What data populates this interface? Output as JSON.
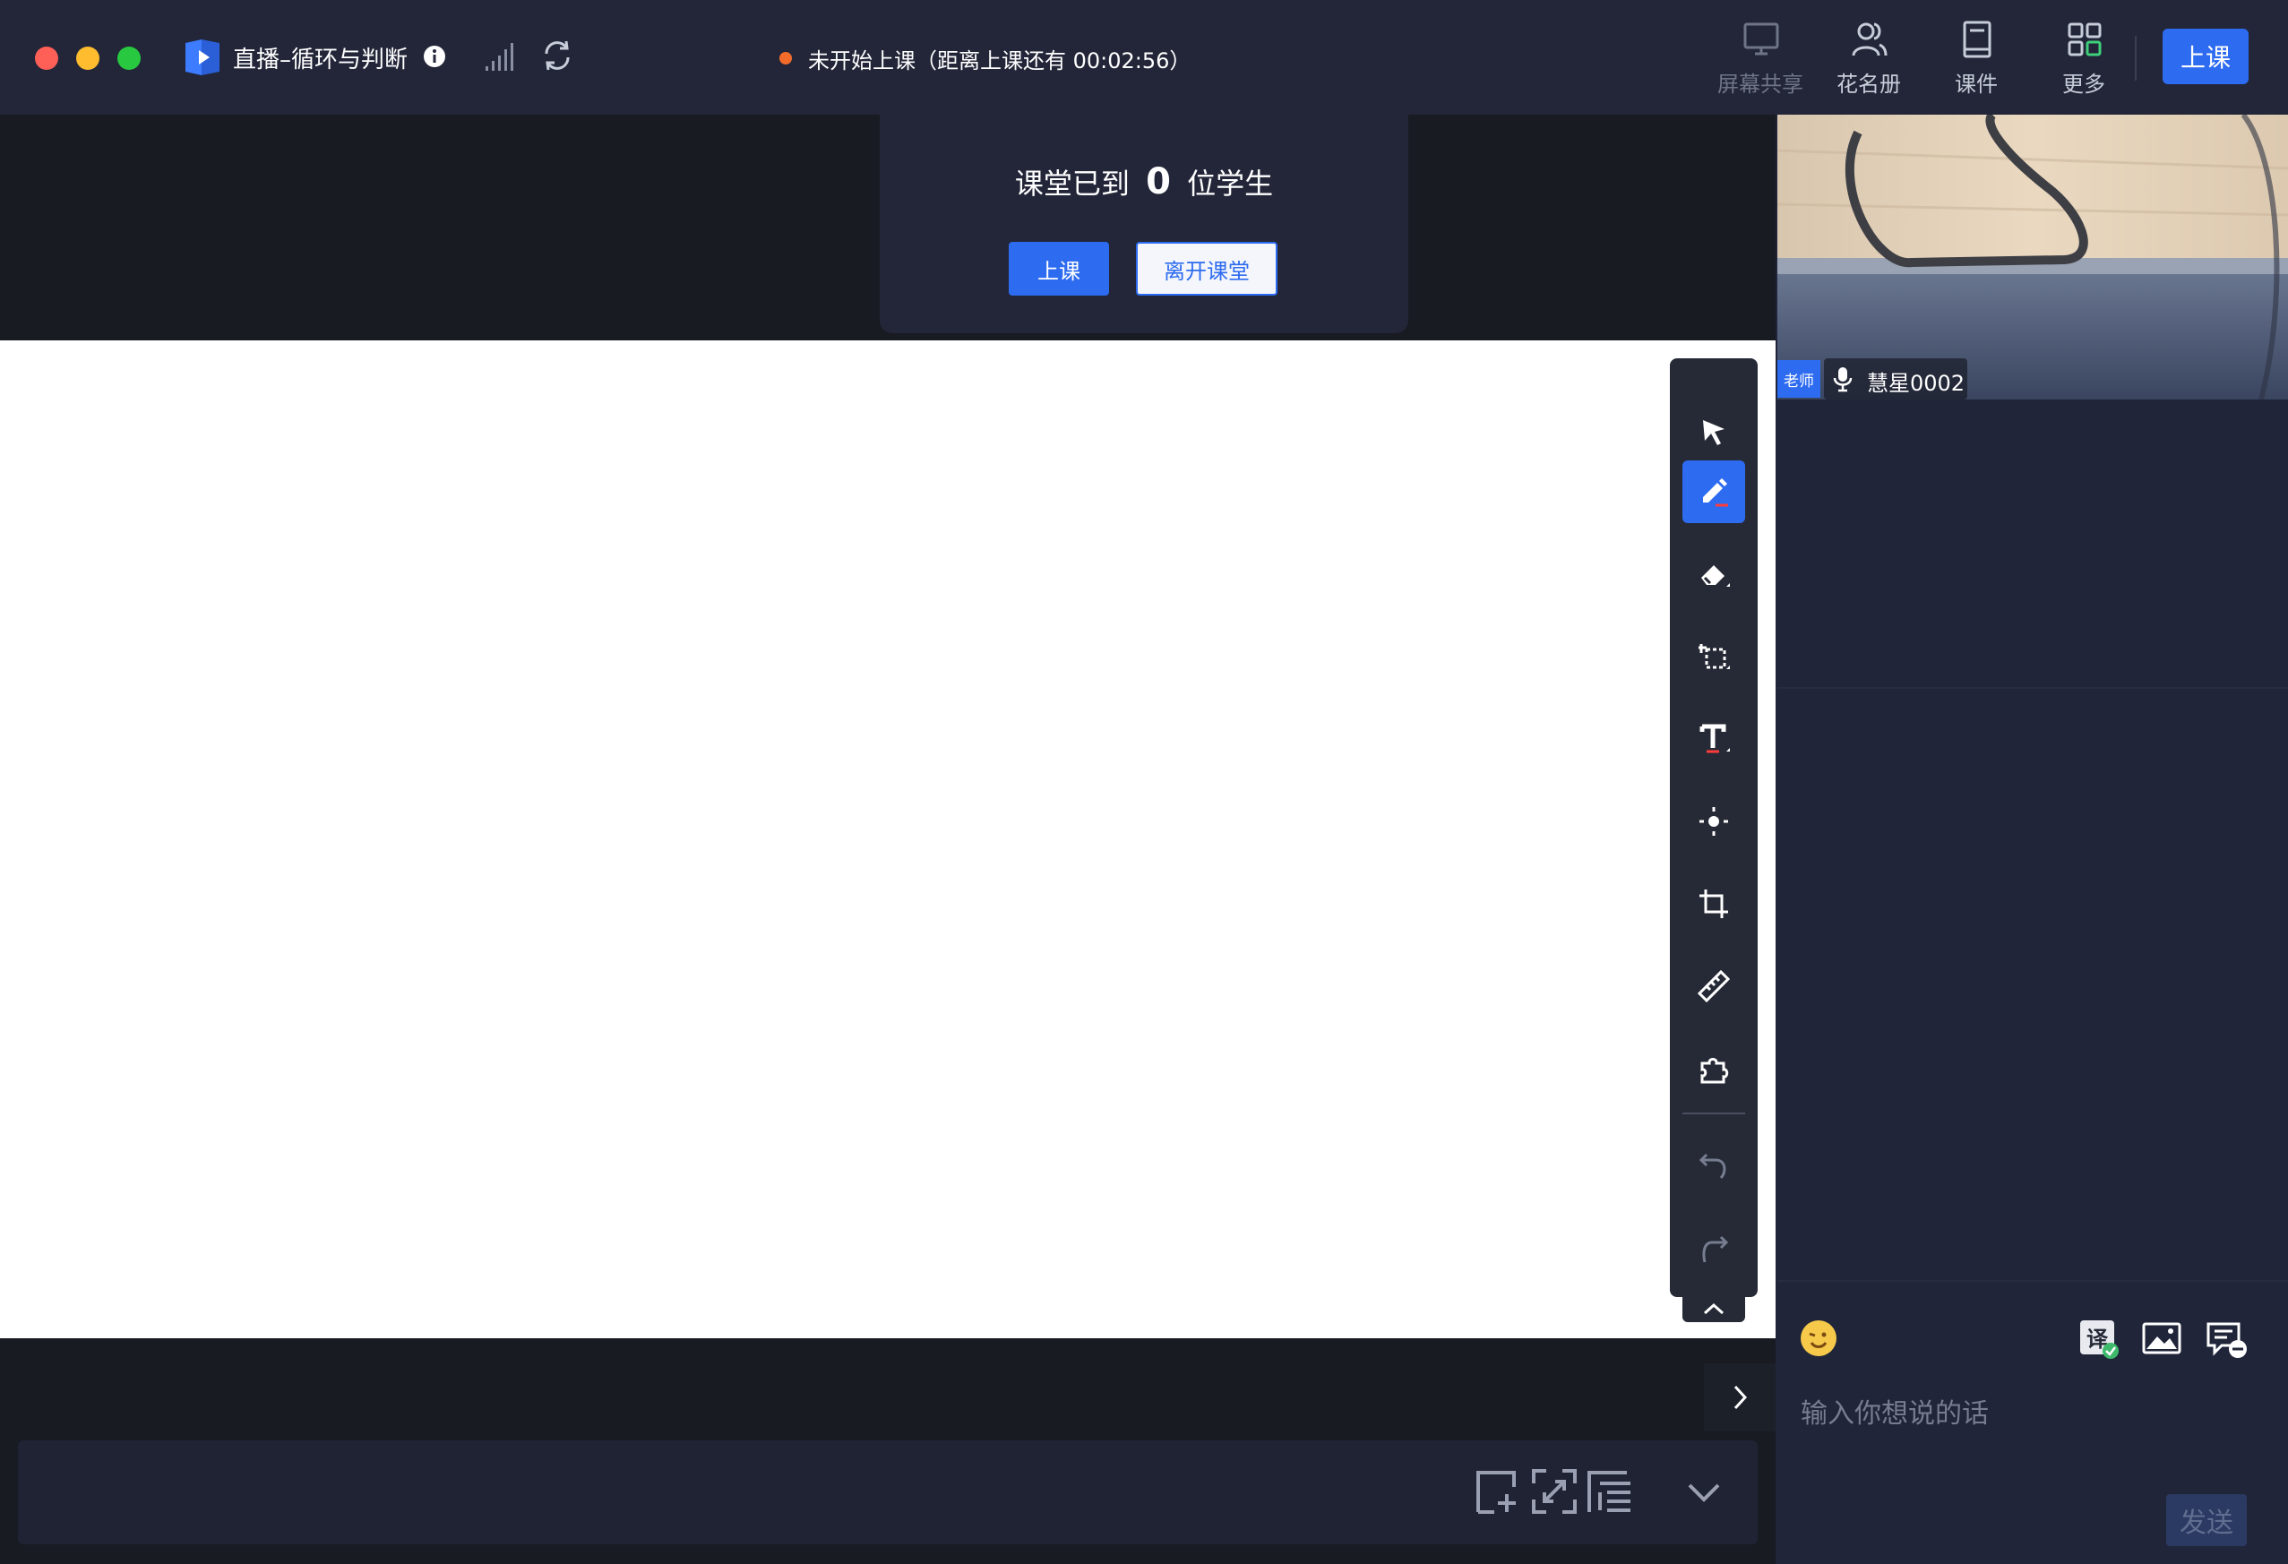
{
  "window": {
    "title": "直播–循环与判断",
    "status_text": "未开始上课（距离上课还有 00:02:56）"
  },
  "toolbar_top": {
    "screen_share": "屏幕共享",
    "roster": "花名册",
    "courseware": "课件",
    "more": "更多",
    "start_class": "上课"
  },
  "attendance": {
    "prefix": "课堂已到",
    "count": "0",
    "suffix": "位学生",
    "start_button": "上课",
    "leave_button": "离开课堂"
  },
  "video": {
    "role_badge": "老师",
    "name": "慧星0002"
  },
  "whiteboard_tools": {
    "items": [
      "select-tool",
      "pen-tool",
      "eraser-tool",
      "area-select-tool",
      "text-tool",
      "laser-pointer-tool",
      "crop-tool",
      "ruler-tool",
      "plugin-tool",
      "undo",
      "redo"
    ],
    "active": "pen-tool"
  },
  "chat": {
    "placeholder": "输入你想说的话",
    "send_label": "发送"
  },
  "colors": {
    "accent": "#2d6bf0",
    "titlebar": "#222638",
    "sidebar": "#20253a",
    "status_dot": "#f26b2b"
  }
}
